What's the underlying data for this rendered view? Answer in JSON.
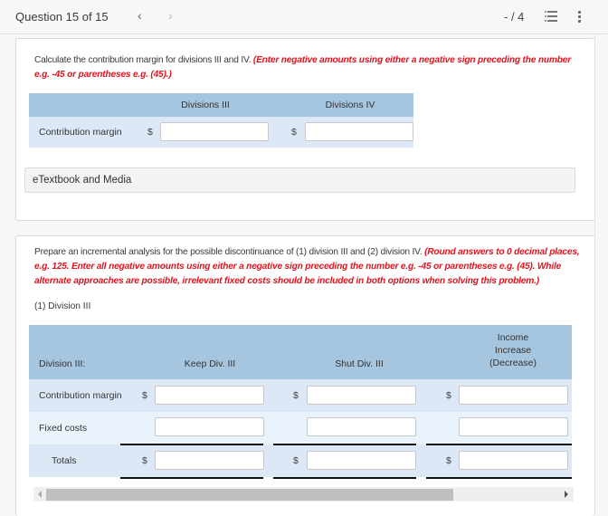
{
  "header": {
    "question_label": "Question 15 of 15",
    "prev_icon": "‹",
    "next_icon": "›",
    "score": "- / 4",
    "list_icon": "list-icon",
    "more_icon": "more-vertical-icon"
  },
  "part1": {
    "prompt": "Calculate the contribution margin for divisions III and IV. ",
    "hint": "(Enter negative amounts using either a negative sign preceding the number e.g. -45 or parentheses e.g. (45).)",
    "columns": [
      "Divisions III",
      "Divisions IV"
    ],
    "rows": [
      {
        "label": "Contribution margin",
        "currency": [
          "$",
          "$"
        ],
        "values": [
          "",
          ""
        ]
      }
    ],
    "etextbook_label": "eTextbook and Media"
  },
  "part2": {
    "prompt": "Prepare an incremental analysis for the possible discontinuance of (1) division III and (2) division IV. ",
    "hint": "(Round answers to 0 decimal places, e.g. 125. Enter all negative amounts using either a negative sign preceding the number e.g. -45 or parentheses e.g. (45). While alternate approaches are possible, irrelevant fixed costs should be included in both options when solving this problem.)",
    "subheading": "(1) Division III",
    "columns": [
      "Division III:",
      "Keep Div. III",
      "Shut Div. III",
      "Income Increase (Decrease)"
    ],
    "column3_lines": [
      "Income",
      "Increase",
      "(Decrease)"
    ],
    "rows": [
      {
        "label": "Contribution margin",
        "currency": [
          "$",
          "$",
          "$"
        ],
        "values": [
          "",
          "",
          ""
        ]
      },
      {
        "label": "Fixed costs",
        "currency": [
          "",
          "",
          ""
        ],
        "values": [
          "",
          "",
          ""
        ]
      },
      {
        "label": "Totals",
        "currency": [
          "$",
          "$",
          "$"
        ],
        "values": [
          "",
          "",
          ""
        ]
      }
    ]
  }
}
